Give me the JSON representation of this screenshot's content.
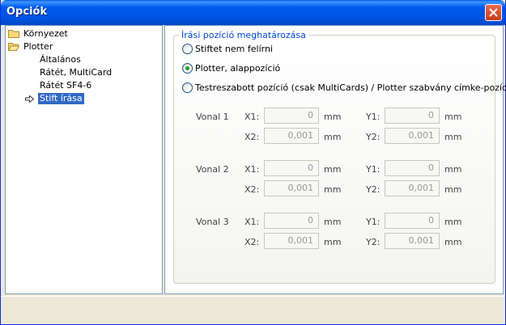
{
  "window": {
    "title": "Opciók"
  },
  "icons": {
    "close": "close-icon",
    "folder": "folder-icon",
    "current": "arrow-right-icon"
  },
  "colors": {
    "titlebar": "#0054e3",
    "selection": "#316ac5",
    "group_title": "#0046d5",
    "radio_checked": "#21a121"
  },
  "tree": {
    "items": [
      {
        "label": "Környezet"
      },
      {
        "label": "Plotter"
      },
      {
        "label": "Általános"
      },
      {
        "label": "Rátét, MultiCard"
      },
      {
        "label": "Rátét SF4-6"
      },
      {
        "label": "Stift írása"
      }
    ]
  },
  "group": {
    "title": "Írási pozíció meghatározása",
    "radios": [
      {
        "label": "Stiftet nem felírni",
        "checked": false
      },
      {
        "label": "Plotter, alappozíció",
        "checked": true
      },
      {
        "label": "Testreszabott pozíció (csak MultiCards) / Plotter szabvány címke-pozíció",
        "checked": false
      }
    ]
  },
  "lines": [
    {
      "name": "Vonal 1",
      "x1_label": "X1:",
      "x1": "0",
      "x2_label": "X2:",
      "x2": "0,001",
      "y1_label": "Y1:",
      "y1": "0",
      "y2_label": "Y2:",
      "y2": "0,001",
      "unit": "mm"
    },
    {
      "name": "Vonal 2",
      "x1_label": "X1:",
      "x1": "0",
      "x2_label": "X2:",
      "x2": "0,001",
      "y1_label": "Y1:",
      "y1": "0",
      "y2_label": "Y2:",
      "y2": "0,001",
      "unit": "mm"
    },
    {
      "name": "Vonal 3",
      "x1_label": "X1:",
      "x1": "0",
      "x2_label": "X2:",
      "x2": "0,001",
      "y1_label": "Y1:",
      "y1": "0",
      "y2_label": "Y2:",
      "y2": "0,001",
      "unit": "mm"
    }
  ]
}
